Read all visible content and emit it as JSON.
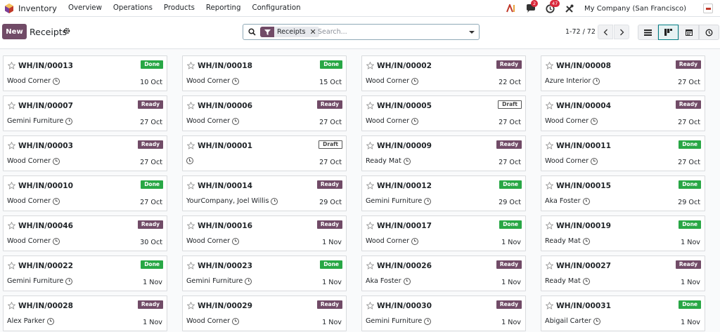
{
  "navbar": {
    "app_title": "Inventory",
    "menus": [
      "Overview",
      "Operations",
      "Products",
      "Reporting",
      "Configuration"
    ],
    "messages_badge": "2",
    "activities_badge": "47",
    "company": "My Company (San Francisco)"
  },
  "control_panel": {
    "new_label": "New",
    "title": "Receipts",
    "facet_label": "Receipts",
    "search_placeholder": "Search...",
    "pager": "1-72 / 72"
  },
  "colors": {
    "primary": "#714b67",
    "done": "#28a745",
    "ready": "#714b67",
    "accent": "#017e84"
  },
  "cards": [
    {
      "ref": "WH/IN/00013",
      "partner": "Wood Corner",
      "date": "10 Oct",
      "status": "Done"
    },
    {
      "ref": "WH/IN/00018",
      "partner": "Wood Corner",
      "date": "15 Oct",
      "status": "Done"
    },
    {
      "ref": "WH/IN/00002",
      "partner": "Wood Corner",
      "date": "22 Oct",
      "status": "Ready"
    },
    {
      "ref": "WH/IN/00008",
      "partner": "Azure Interior",
      "date": "27 Oct",
      "status": "Ready"
    },
    {
      "ref": "WH/IN/00007",
      "partner": "Gemini Furniture",
      "date": "27 Oct",
      "status": "Ready"
    },
    {
      "ref": "WH/IN/00006",
      "partner": "Wood Corner",
      "date": "27 Oct",
      "status": "Ready"
    },
    {
      "ref": "WH/IN/00005",
      "partner": "Wood Corner",
      "date": "27 Oct",
      "status": "Draft"
    },
    {
      "ref": "WH/IN/00004",
      "partner": "Wood Corner",
      "date": "27 Oct",
      "status": "Ready"
    },
    {
      "ref": "WH/IN/00003",
      "partner": "Wood Corner",
      "date": "27 Oct",
      "status": "Ready"
    },
    {
      "ref": "WH/IN/00001",
      "partner": "",
      "date": "27 Oct",
      "status": "Draft"
    },
    {
      "ref": "WH/IN/00009",
      "partner": "Ready Mat",
      "date": "27 Oct",
      "status": "Ready"
    },
    {
      "ref": "WH/IN/00011",
      "partner": "Wood Corner",
      "date": "27 Oct",
      "status": "Done"
    },
    {
      "ref": "WH/IN/00010",
      "partner": "Wood Corner",
      "date": "27 Oct",
      "status": "Done"
    },
    {
      "ref": "WH/IN/00014",
      "partner": "YourCompany, Joel Willis",
      "date": "29 Oct",
      "status": "Ready"
    },
    {
      "ref": "WH/IN/00012",
      "partner": "Gemini Furniture",
      "date": "29 Oct",
      "status": "Done"
    },
    {
      "ref": "WH/IN/00015",
      "partner": "Aka Foster",
      "date": "29 Oct",
      "status": "Done"
    },
    {
      "ref": "WH/IN/00046",
      "partner": "Wood Corner",
      "date": "30 Oct",
      "status": "Ready"
    },
    {
      "ref": "WH/IN/00016",
      "partner": "Wood Corner",
      "date": "1 Nov",
      "status": "Ready"
    },
    {
      "ref": "WH/IN/00017",
      "partner": "Wood Corner",
      "date": "1 Nov",
      "status": "Done"
    },
    {
      "ref": "WH/IN/00019",
      "partner": "Ready Mat",
      "date": "1 Nov",
      "status": "Done"
    },
    {
      "ref": "WH/IN/00022",
      "partner": "Gemini Furniture",
      "date": "1 Nov",
      "status": "Done"
    },
    {
      "ref": "WH/IN/00023",
      "partner": "Gemini Furniture",
      "date": "1 Nov",
      "status": "Done"
    },
    {
      "ref": "WH/IN/00026",
      "partner": "Aka Foster",
      "date": "1 Nov",
      "status": "Ready"
    },
    {
      "ref": "WH/IN/00027",
      "partner": "Ready Mat",
      "date": "1 Nov",
      "status": "Ready"
    },
    {
      "ref": "WH/IN/00028",
      "partner": "Alex Parker",
      "date": "1 Nov",
      "status": "Ready"
    },
    {
      "ref": "WH/IN/00029",
      "partner": "Wood Corner",
      "date": "1 Nov",
      "status": "Ready"
    },
    {
      "ref": "WH/IN/00030",
      "partner": "Gemini Furniture",
      "date": "1 Nov",
      "status": "Ready"
    },
    {
      "ref": "WH/IN/00031",
      "partner": "Abigail Carter",
      "date": "1 Nov",
      "status": "Done"
    }
  ]
}
